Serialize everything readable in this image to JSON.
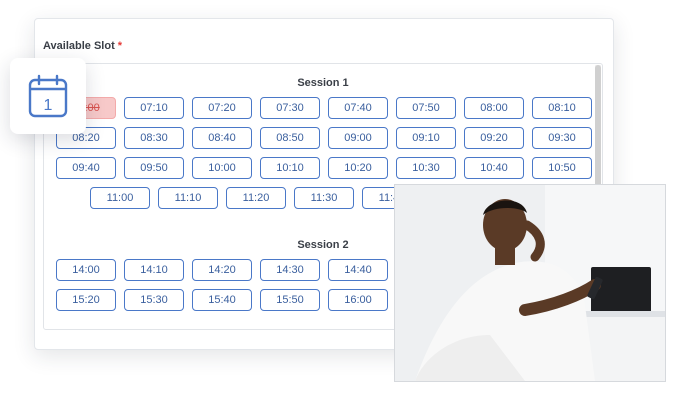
{
  "form": {
    "label": "Available Slot",
    "required_mark": "*"
  },
  "calendar_badge": {
    "icon": "calendar-icon",
    "day": "1"
  },
  "sessions": [
    {
      "title": "Session 1",
      "rows": [
        [
          "07:00",
          "07:10",
          "07:20",
          "07:30",
          "07:40",
          "07:50",
          "08:00",
          "08:10"
        ],
        [
          "08:20",
          "08:30",
          "08:40",
          "08:50",
          "09:00",
          "09:10",
          "09:20",
          "09:30"
        ],
        [
          "09:40",
          "09:50",
          "10:00",
          "10:10",
          "10:20",
          "10:30",
          "10:40",
          "10:50"
        ],
        [
          "11:00",
          "11:10",
          "11:20",
          "11:30",
          "11:40"
        ]
      ],
      "booked": [
        "07:00"
      ]
    },
    {
      "title": "Session 2",
      "rows": [
        [
          "14:00",
          "14:10",
          "14:20",
          "14:30",
          "14:40"
        ],
        [
          "15:20",
          "15:30",
          "15:40",
          "15:50",
          "16:00"
        ]
      ],
      "booked": []
    }
  ],
  "photo": {
    "subject": "man-using-phone-photo"
  },
  "colors": {
    "slot_border": "#4a78c8",
    "slot_text": "#3a5f9e",
    "booked_bg": "#f7c9c9",
    "booked_text": "#d9534f",
    "required": "#e53935"
  }
}
